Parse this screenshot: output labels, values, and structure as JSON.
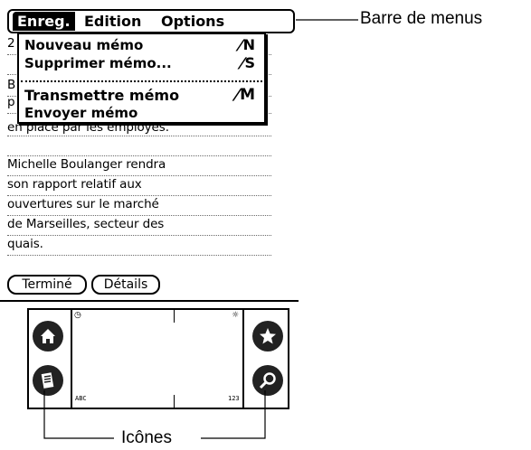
{
  "menubar": {
    "menus": [
      "Enreg.",
      "Edition",
      "Options"
    ]
  },
  "dropdown": {
    "items": [
      {
        "label": "Nouveau mémo",
        "shortcut": "N"
      },
      {
        "label": "Supprimer mémo...",
        "shortcut": "S"
      },
      {
        "label": "Transmettre mémo",
        "shortcut": "M"
      },
      {
        "label": "Envoyer mémo",
        "shortcut": ""
      }
    ]
  },
  "memo": {
    "partial_lines": [
      "2",
      "B",
      "p"
    ],
    "line_after_menu": "en place par les employés.",
    "lines": [
      "Michelle Boulanger rendra",
      "son rapport relatif aux",
      "ouvertures sur le marché",
      "de Marseilles, secteur des",
      "quais."
    ]
  },
  "buttons": {
    "done": "Terminé",
    "details": "Détails"
  },
  "graffiti": {
    "abc": "ABC",
    "num": "123",
    "icons": [
      "home-icon",
      "menu-icon",
      "favorite-icon",
      "find-icon",
      "clock-icon",
      "brightness-icon"
    ]
  },
  "callouts": {
    "menubar_label": "Barre de menus",
    "icons_label": "Icônes"
  }
}
